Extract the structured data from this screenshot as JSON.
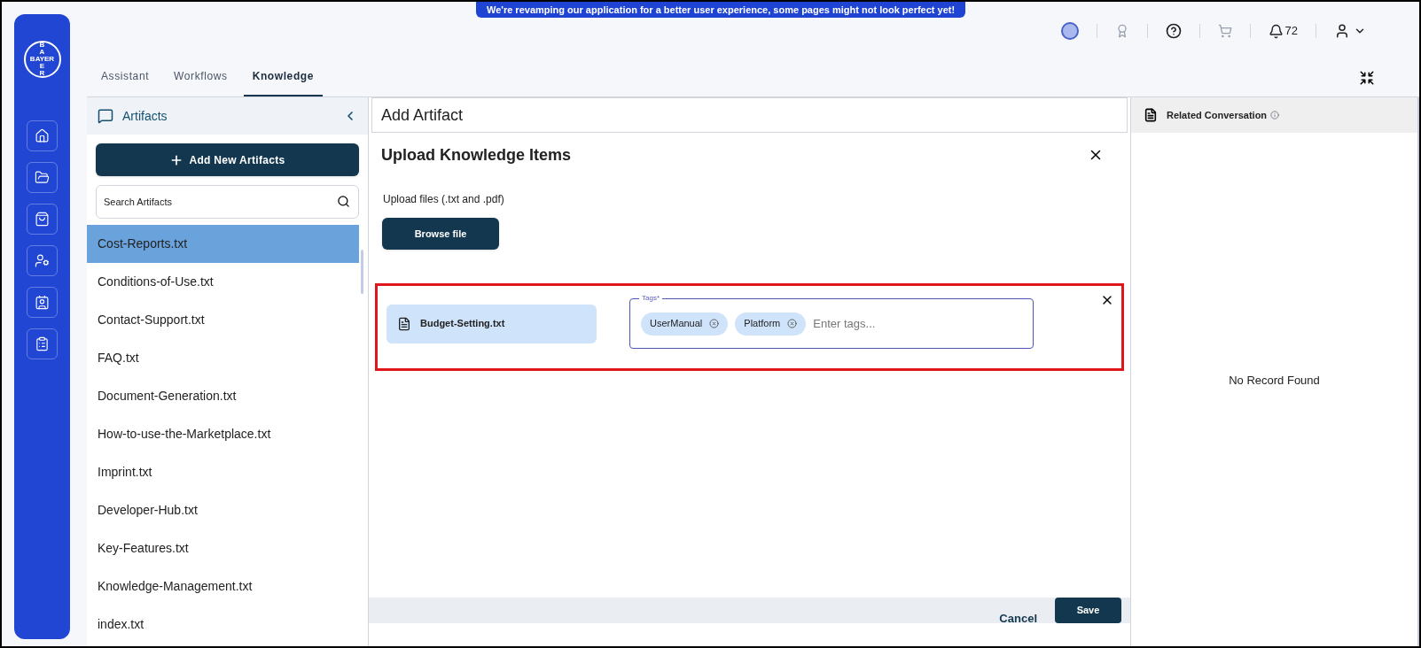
{
  "banner": "We're revamping our application for a better user experience, some pages might not look perfect yet!",
  "logo": {
    "horizontal": "BAYER",
    "vertical_top": "BA",
    "vertical_bottom": "ER"
  },
  "sidebar": {
    "items": [
      {
        "kind": "home",
        "selected": false
      },
      {
        "kind": "folder",
        "selected": false
      },
      {
        "kind": "bag",
        "selected": false
      },
      {
        "kind": "user-gear",
        "selected": false
      },
      {
        "kind": "contacts",
        "selected": false
      },
      {
        "kind": "clipboard",
        "selected": false
      }
    ]
  },
  "header": {
    "notifications": "72"
  },
  "tabs": [
    {
      "label": "Assistant",
      "selected": false
    },
    {
      "label": "Workflows",
      "selected": false
    },
    {
      "label": "Knowledge",
      "selected": true
    }
  ],
  "artifacts": {
    "title": "Artifacts",
    "add_button": "Add New Artifacts",
    "search": {
      "placeholder": "Search Artifacts"
    },
    "items": [
      {
        "name": "Cost-Reports.txt",
        "selected": true
      },
      {
        "name": "Conditions-of-Use.txt",
        "selected": false
      },
      {
        "name": "Contact-Support.txt",
        "selected": false
      },
      {
        "name": "FAQ.txt",
        "selected": false
      },
      {
        "name": "Document-Generation.txt",
        "selected": false
      },
      {
        "name": "How-to-use-the-Marketplace.txt",
        "selected": false
      },
      {
        "name": "Imprint.txt",
        "selected": false
      },
      {
        "name": "Developer-Hub.txt",
        "selected": false
      },
      {
        "name": "Key-Features.txt",
        "selected": false
      },
      {
        "name": "Knowledge-Management.txt",
        "selected": false
      },
      {
        "name": "index.txt",
        "selected": false
      }
    ]
  },
  "editor": {
    "title_field": {
      "value": "Add Artifact"
    },
    "dialog": {
      "title": "Upload Knowledge Items",
      "hint": "Upload files (.txt and .pdf)",
      "browse_button": "Browse file",
      "file": {
        "name": "Budget-Setting.txt",
        "highlighted": true,
        "tags_field": {
          "label": "Tags*",
          "tags": [
            "UserManual",
            "Platform"
          ],
          "placeholder": "Enter tags..."
        }
      },
      "cancel": "Cancel",
      "save": "Save"
    }
  },
  "related": {
    "title": "Related Conversation",
    "empty": "No Record Found"
  }
}
